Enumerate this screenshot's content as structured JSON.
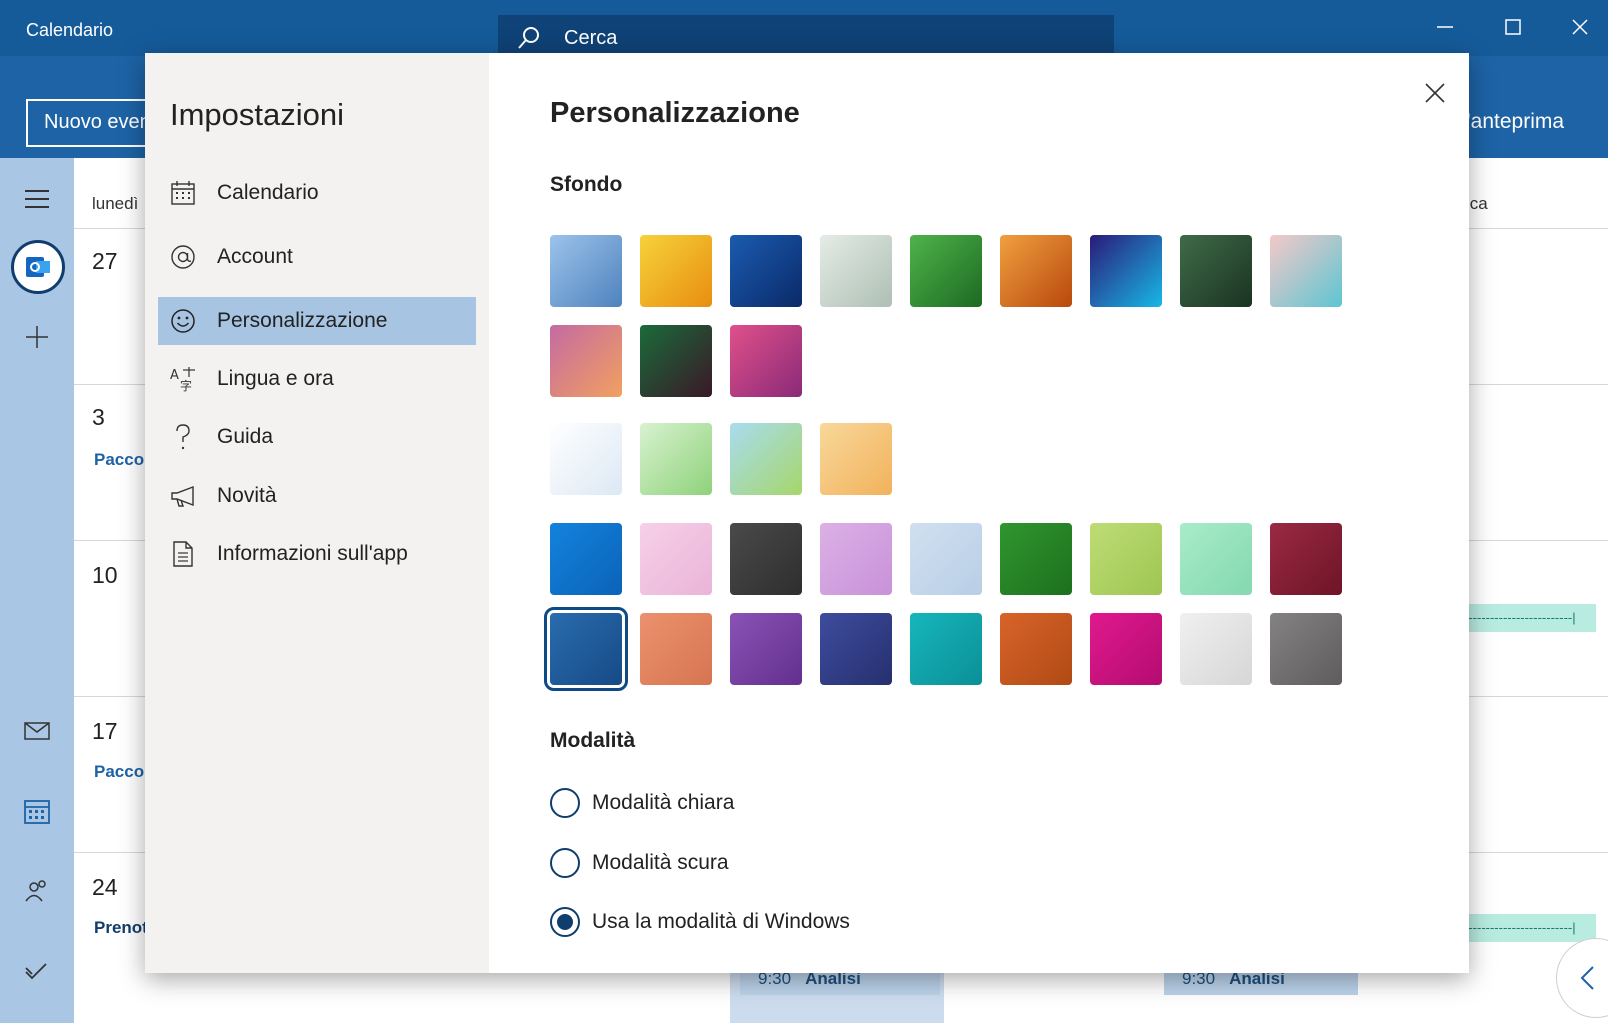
{
  "app": {
    "title": "Calendario",
    "search_placeholder": "Cerca",
    "new_event_label": "Nuovo evento",
    "preview_label": "l'anteprima"
  },
  "calendar": {
    "day_header_left": "lunedì",
    "day_header_right": "ica",
    "weeks": [
      {
        "day": "27",
        "event": ""
      },
      {
        "day": "3",
        "event": "Pacco"
      },
      {
        "day": "10",
        "event": ""
      },
      {
        "day": "17",
        "event": "Pacco"
      },
      {
        "day": "24",
        "event": "Prenot"
      }
    ],
    "dashed_text": "-------------------------|",
    "bottom_events": [
      {
        "time": "9:30",
        "title": "Analisi"
      },
      {
        "time": "9:30",
        "title": "Analisi"
      }
    ]
  },
  "settings": {
    "title": "Impostazioni",
    "nav": [
      {
        "label": "Calendario",
        "icon": "calendar-icon",
        "active": false
      },
      {
        "label": "Account",
        "icon": "at-sign-icon",
        "active": false
      },
      {
        "label": "Personalizzazione",
        "icon": "smiley-icon",
        "active": true
      },
      {
        "label": "Lingua e ora",
        "icon": "language-icon",
        "active": false
      },
      {
        "label": "Guida",
        "icon": "question-icon",
        "active": false
      },
      {
        "label": "Novità",
        "icon": "megaphone-icon",
        "active": false
      },
      {
        "label": "Informazioni sull'app",
        "icon": "document-icon",
        "active": false
      }
    ],
    "panel": {
      "title": "Personalizzazione",
      "background_heading": "Sfondo",
      "photo_backgrounds": [
        {
          "name": "mountain-snow",
          "colors": [
            "#9cc3ea",
            "#4f82be"
          ]
        },
        {
          "name": "yellow-leaves",
          "colors": [
            "#f6d23a",
            "#e88e10"
          ]
        },
        {
          "name": "blue-building",
          "colors": [
            "#1b5bb0",
            "#0a2a68"
          ]
        },
        {
          "name": "misty-leaves",
          "colors": [
            "#e4ece6",
            "#aebfb4"
          ]
        },
        {
          "name": "green-clover",
          "colors": [
            "#4fb34a",
            "#1d6a22"
          ]
        },
        {
          "name": "orange-dandelion",
          "colors": [
            "#f0a040",
            "#b8480c"
          ]
        },
        {
          "name": "blue-flower",
          "colors": [
            "#2a1a78",
            "#18b8e6"
          ]
        },
        {
          "name": "pine-forest",
          "colors": [
            "#3f6b48",
            "#1b3322"
          ]
        },
        {
          "name": "pink-wave",
          "colors": [
            "#f5c8c8",
            "#5cc6d2"
          ]
        },
        {
          "name": "purple-orange",
          "colors": [
            "#c46aa2",
            "#f2a060"
          ]
        },
        {
          "name": "aurora",
          "colors": [
            "#1a6b3a",
            "#3a1828"
          ]
        },
        {
          "name": "pink-petals",
          "colors": [
            "#e0508a",
            "#8a2a78"
          ]
        }
      ],
      "illustration_backgrounds": [
        {
          "name": "snowman",
          "colors": [
            "#ffffff",
            "#dce8f4"
          ]
        },
        {
          "name": "green-trees",
          "colors": [
            "#d8f2d0",
            "#8ed27a"
          ]
        },
        {
          "name": "meadow-flowers",
          "colors": [
            "#a8dcf0",
            "#a6d66a"
          ]
        },
        {
          "name": "scarecrow",
          "colors": [
            "#f8d89a",
            "#f2b25c"
          ]
        }
      ],
      "color_backgrounds": [
        {
          "name": "blue",
          "colors": [
            "#1382dd",
            "#0b63b8"
          ],
          "selected": false
        },
        {
          "name": "light-pink",
          "colors": [
            "#f6d0e8",
            "#eab4d8"
          ],
          "selected": false
        },
        {
          "name": "dark-gray",
          "colors": [
            "#4a4a4a",
            "#2e2e2e"
          ],
          "selected": false
        },
        {
          "name": "lilac",
          "colors": [
            "#dcb0e6",
            "#c892d8"
          ],
          "selected": false
        },
        {
          "name": "light-blue",
          "colors": [
            "#d0e0f0",
            "#b8cee6"
          ],
          "selected": false
        },
        {
          "name": "green",
          "colors": [
            "#2f962e",
            "#1d701e"
          ],
          "selected": false
        },
        {
          "name": "lime",
          "colors": [
            "#bedc76",
            "#9ec652"
          ],
          "selected": false
        },
        {
          "name": "mint",
          "colors": [
            "#a8ecc8",
            "#84d8b0"
          ],
          "selected": false
        },
        {
          "name": "burgundy",
          "colors": [
            "#9a2a44",
            "#6e1426"
          ],
          "selected": false
        },
        {
          "name": "dark-blue",
          "colors": [
            "#2a6cae",
            "#164a86"
          ],
          "selected": true
        },
        {
          "name": "coral",
          "colors": [
            "#ec926e",
            "#d67450"
          ],
          "selected": false
        },
        {
          "name": "purple",
          "colors": [
            "#8a52b6",
            "#63308e"
          ],
          "selected": false
        },
        {
          "name": "navy",
          "colors": [
            "#3e4c9e",
            "#26306e"
          ],
          "selected": false
        },
        {
          "name": "teal",
          "colors": [
            "#16b6bc",
            "#0a9096"
          ],
          "selected": false
        },
        {
          "name": "burnt-orange",
          "colors": [
            "#d8642a",
            "#b04a14"
          ],
          "selected": false
        },
        {
          "name": "magenta",
          "colors": [
            "#e0198e",
            "#b40c70"
          ],
          "selected": false
        },
        {
          "name": "light-gray",
          "colors": [
            "#f0f0f0",
            "#d6d6d6"
          ],
          "selected": false
        },
        {
          "name": "gray",
          "colors": [
            "#848282",
            "#5e5c5c"
          ],
          "selected": false
        }
      ],
      "mode_heading": "Modalità",
      "modes": [
        {
          "label": "Modalità chiara",
          "checked": false
        },
        {
          "label": "Modalità scura",
          "checked": false
        },
        {
          "label": "Usa la modalità di Windows",
          "checked": true
        }
      ]
    }
  }
}
